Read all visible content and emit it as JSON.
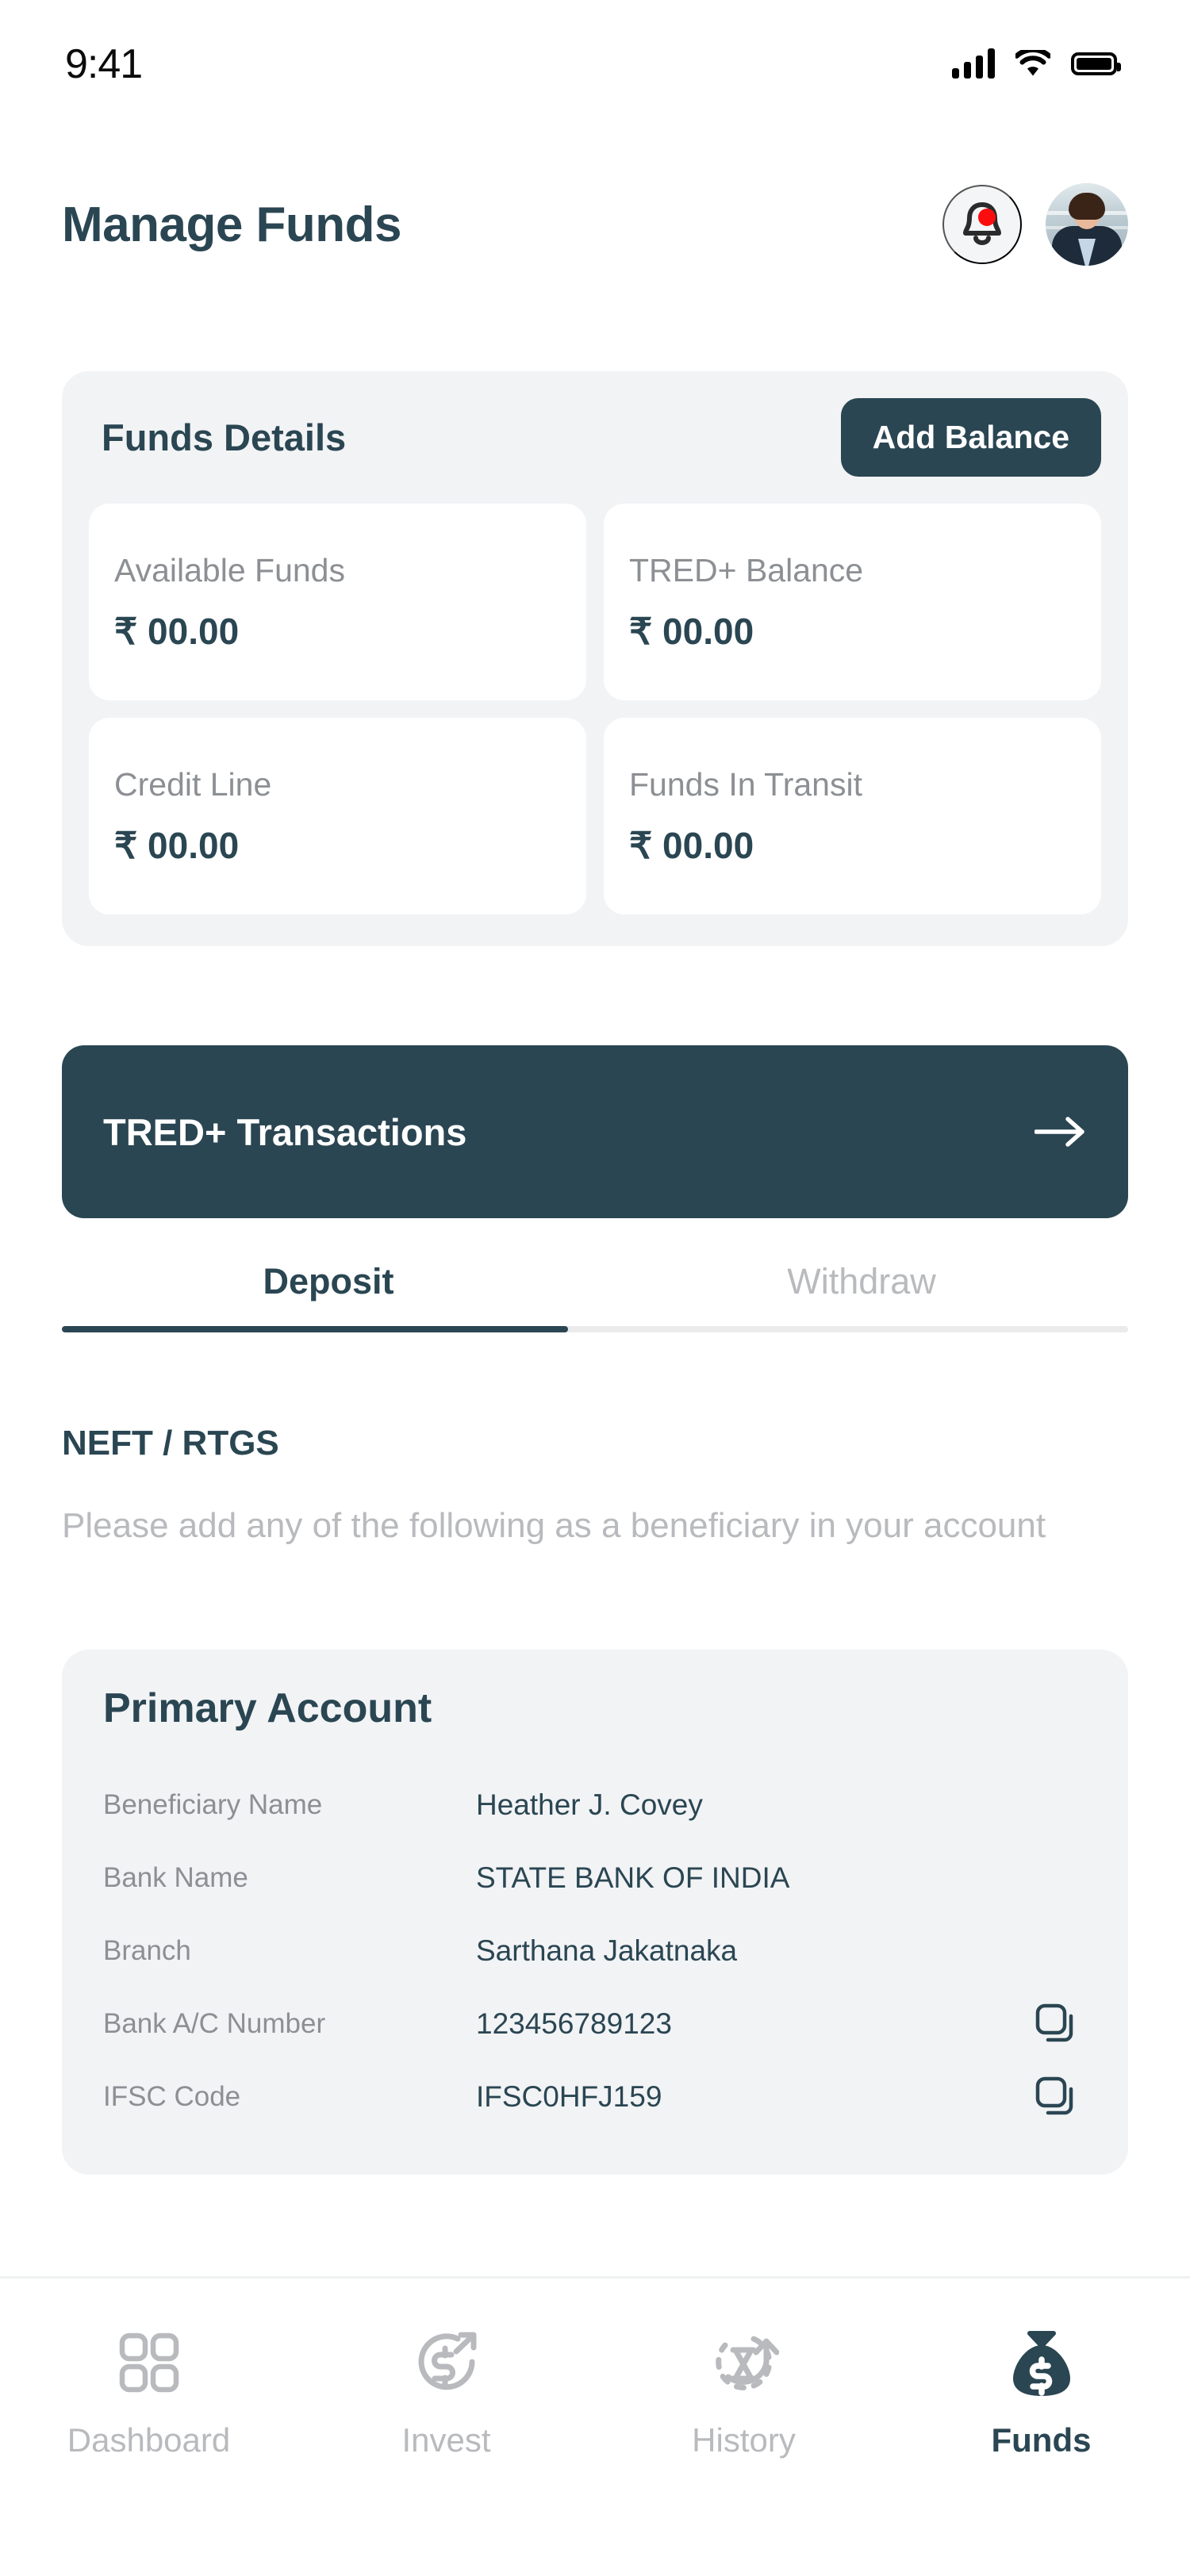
{
  "status_bar": {
    "time": "9:41",
    "icons": [
      "signal-bars-icon",
      "wifi-icon",
      "battery-icon"
    ]
  },
  "header": {
    "title": "Manage Funds",
    "notification_icon": "bell-icon",
    "has_notification_badge": true,
    "avatar_alt": "user-avatar"
  },
  "funds_panel": {
    "title": "Funds Details",
    "add_balance_label": "Add Balance",
    "cards": [
      {
        "label": "Available Funds",
        "value": "₹ 00.00"
      },
      {
        "label": "TRED+ Balance",
        "value": "₹ 00.00"
      },
      {
        "label": "Credit Line",
        "value": "₹ 00.00"
      },
      {
        "label": "Funds In Transit",
        "value": "₹ 00.00"
      }
    ]
  },
  "tred_transactions": {
    "label": "TRED+ Transactions",
    "arrow_icon": "arrow-right-icon"
  },
  "tabs": {
    "items": [
      {
        "label": "Deposit",
        "active": true
      },
      {
        "label": "Withdraw",
        "active": false
      }
    ]
  },
  "transfer_section": {
    "title": "NEFT / RTGS",
    "description": "Please add any of the following as a beneficiary in your account"
  },
  "primary_account": {
    "title": "Primary Account",
    "rows": [
      {
        "label": "Beneficiary Name",
        "value": "Heather J. Covey",
        "copyable": false
      },
      {
        "label": "Bank Name",
        "value": "STATE BANK OF INDIA",
        "copyable": false
      },
      {
        "label": "Branch",
        "value": "Sarthana Jakatnaka",
        "copyable": false
      },
      {
        "label": "Bank A/C Number",
        "value": "123456789123",
        "copyable": true
      },
      {
        "label": "IFSC Code",
        "value": "IFSC0HFJ159",
        "copyable": true
      }
    ],
    "copy_icon": "copy-icon"
  },
  "bottom_nav": {
    "items": [
      {
        "label": "Dashboard",
        "icon": "grid-icon",
        "active": false
      },
      {
        "label": "Invest",
        "icon": "dollar-arrow-icon",
        "active": false
      },
      {
        "label": "History",
        "icon": "hourglass-rotate-icon",
        "active": false
      },
      {
        "label": "Funds",
        "icon": "money-bag-icon",
        "active": true
      }
    ]
  },
  "colors": {
    "accent": "#2a4652",
    "muted": "#8c8f93",
    "placeholder": "#b8babd",
    "panel_bg": "#f2f3f5",
    "badge": "#fc0d0d"
  }
}
